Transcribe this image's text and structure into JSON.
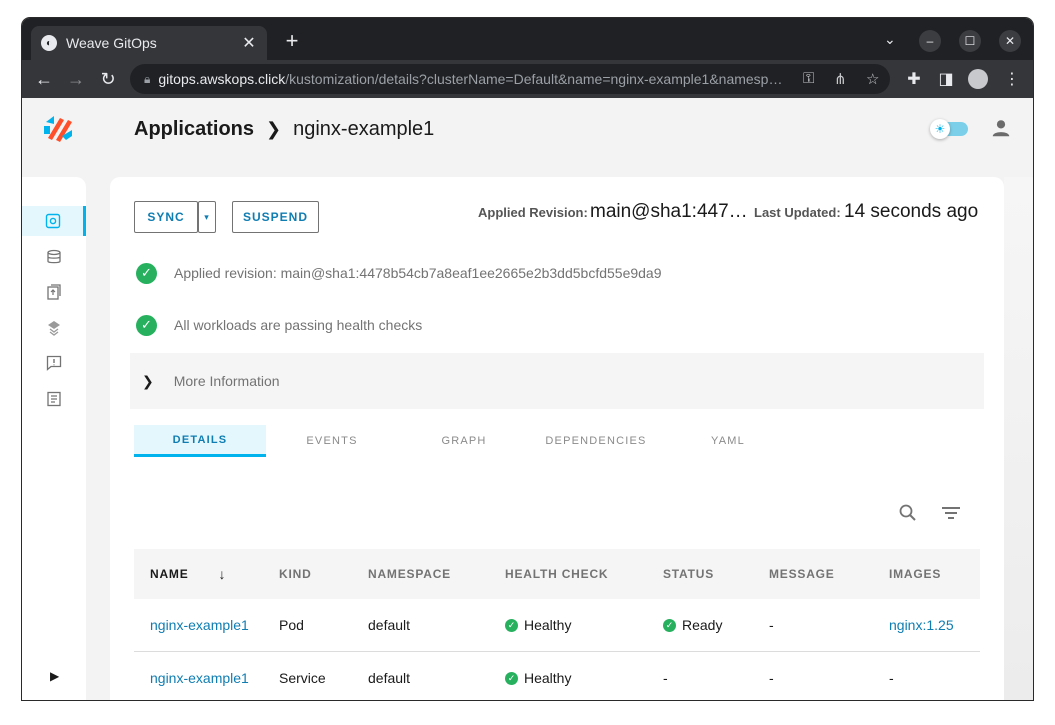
{
  "browser": {
    "tab_title": "Weave GitOps",
    "tab_close": "✕",
    "new_tab": "+",
    "url_host": "gitops.awskops.click",
    "url_path": "/kustomization/details?clusterName=Default&name=nginx-example1&namesp…"
  },
  "header": {
    "breadcrumb_root": "Applications",
    "breadcrumb_current": "nginx-example1"
  },
  "actions": {
    "sync_label": "SYNC",
    "suspend_label": "SUSPEND",
    "applied_revision_label": "Applied Revision:",
    "applied_revision_value": "main@sha1:447…",
    "last_updated_label": "Last Updated:",
    "last_updated_value": "14 seconds ago"
  },
  "conditions": [
    {
      "text": "Applied revision: main@sha1:4478b54cb7a8eaf1ee2665e2b3dd5bcfd55e9da9"
    },
    {
      "text": "All workloads are passing health checks"
    }
  ],
  "more_info_label": "More Information",
  "tabs": [
    {
      "label": "DETAILS"
    },
    {
      "label": "EVENTS"
    },
    {
      "label": "GRAPH"
    },
    {
      "label": "DEPENDENCIES"
    },
    {
      "label": "YAML"
    }
  ],
  "table": {
    "columns": [
      "NAME",
      "KIND",
      "NAMESPACE",
      "HEALTH CHECK",
      "STATUS",
      "MESSAGE",
      "IMAGES"
    ],
    "rows": [
      {
        "name": "nginx-example1",
        "kind": "Pod",
        "namespace": "default",
        "health": "Healthy",
        "status": "Ready",
        "message": "-",
        "images": "nginx:1.25"
      },
      {
        "name": "nginx-example1",
        "kind": "Service",
        "namespace": "default",
        "health": "Healthy",
        "status": "-",
        "message": "-",
        "images": "-"
      }
    ]
  },
  "colors": {
    "accent": "#00b3ec",
    "link": "#0f7db2",
    "success": "#27b15f"
  }
}
